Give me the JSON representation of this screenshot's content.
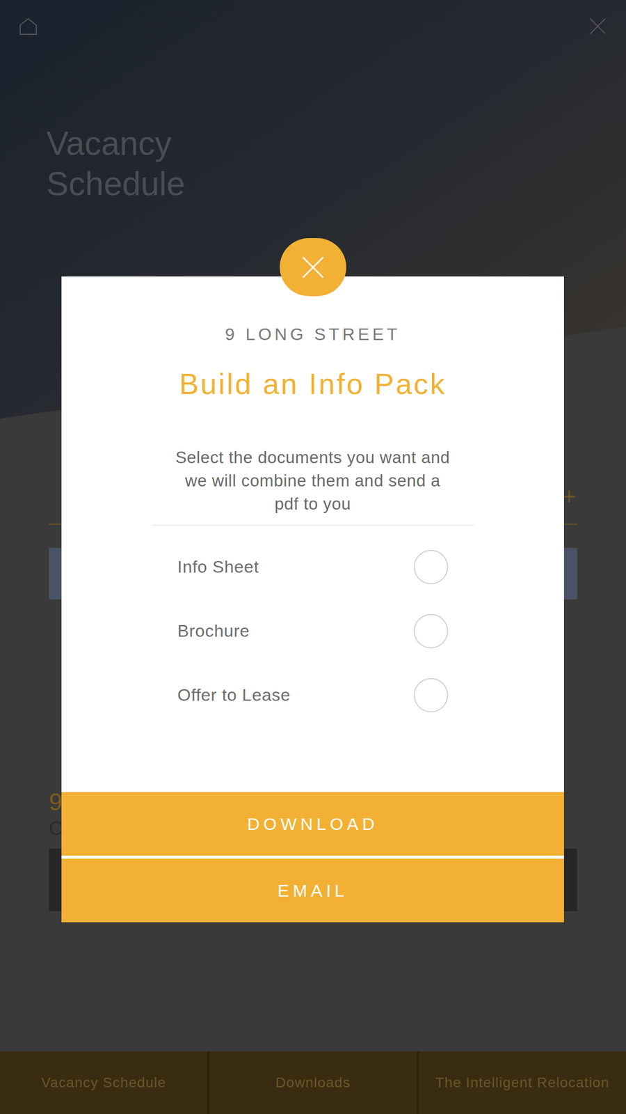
{
  "header": {
    "title": "Vacancy Schedule"
  },
  "page": {
    "expand": "+",
    "card_number": "9",
    "card_text": "C"
  },
  "modal": {
    "subtitle": "9 LONG STREET",
    "title": "Build an Info Pack",
    "description": "Select the documents you want and we will combine them and send a pdf to you",
    "documents": [
      {
        "label": "Info Sheet",
        "selected": false
      },
      {
        "label": "Brochure",
        "selected": false
      },
      {
        "label": "Offer to Lease",
        "selected": false
      }
    ],
    "buttons": [
      "DOWNLOAD",
      "EMAIL"
    ]
  },
  "tabs": [
    {
      "label": "Vacancy Schedule",
      "selected": false
    },
    {
      "label": "Downloads",
      "selected": false
    },
    {
      "label": "The Intelligent Relocation",
      "selected": false
    }
  ]
}
